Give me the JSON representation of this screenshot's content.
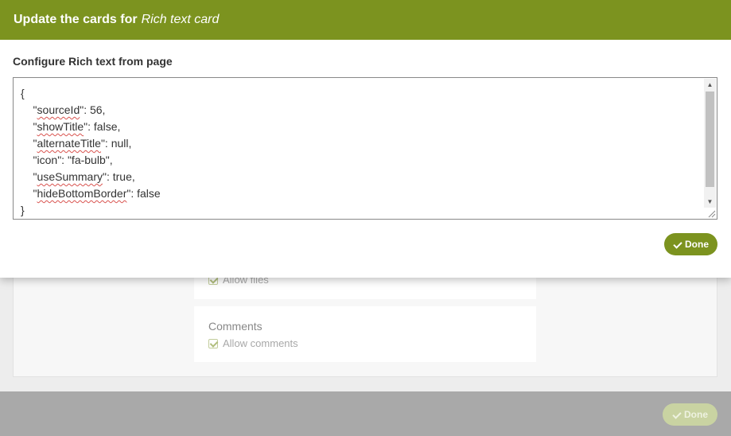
{
  "modal": {
    "title_prefix": "Update the cards for",
    "title_card": "Rich text card",
    "field_label": "Configure Rich text from page",
    "json_lines": [
      {
        "pre": "{",
        "key": "",
        "post": ""
      },
      {
        "pre": "    \"",
        "key": "sourceId",
        "post": "\": 56,"
      },
      {
        "pre": "    \"",
        "key": "showTitle",
        "post": "\": false,"
      },
      {
        "pre": "    \"",
        "key": "alternateTitle",
        "post": "\": null,"
      },
      {
        "pre": "    \"icon\": \"fa-bulb\",",
        "key": "",
        "post": ""
      },
      {
        "pre": "    \"",
        "key": "useSummary",
        "post": "\": true,"
      },
      {
        "pre": "    \"",
        "key": "hideBottomBorder",
        "post": "\": false"
      },
      {
        "pre": "}",
        "key": "",
        "post": ""
      }
    ],
    "done_label": "Done"
  },
  "background": {
    "files_option": "Allow files",
    "comments_title": "Comments",
    "comments_option": "Allow comments",
    "footer_done_label": "Done"
  },
  "colors": {
    "accent": "#7c931f",
    "footer": "#a9a9a9"
  }
}
